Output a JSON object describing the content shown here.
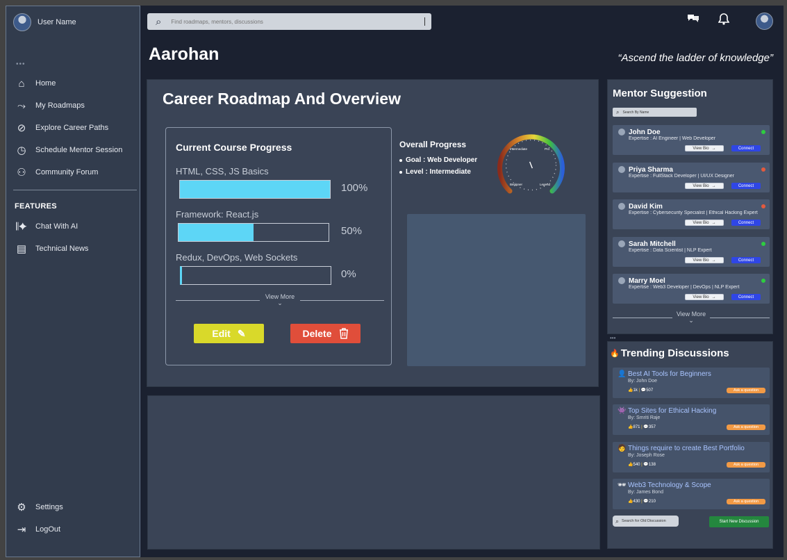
{
  "user": {
    "name": "User Name"
  },
  "sidebar": {
    "items": [
      {
        "label": "Home",
        "icon": "home-icon"
      },
      {
        "label": "My Roadmaps",
        "icon": "roadmap-icon"
      },
      {
        "label": "Explore Career Paths",
        "icon": "compass-icon"
      },
      {
        "label": "Schedule Mentor Session",
        "icon": "clock-icon"
      },
      {
        "label": "Community Forum",
        "icon": "community-icon"
      }
    ],
    "features_label": "FEATURES",
    "features": [
      {
        "label": "Chat With AI",
        "icon": "ai-sparkle-icon"
      },
      {
        "label": "Technical News",
        "icon": "news-icon"
      }
    ],
    "bottom": [
      {
        "label": "Settings",
        "icon": "gear-icon"
      },
      {
        "label": "LogOut",
        "icon": "logout-icon"
      }
    ]
  },
  "search": {
    "placeholder": "Find roadmaps, mentors, discussions"
  },
  "header": {
    "title": "Aarohan",
    "tagline": "“Ascend the ladder of knowledge”"
  },
  "career": {
    "title": "Career Roadmap And Overview",
    "progress_title": "Current Course Progress",
    "courses": [
      {
        "label": "HTML, CSS, JS Basics",
        "progress": 100,
        "pct_text": "100%"
      },
      {
        "label": "Framework: React.js",
        "progress": 50,
        "pct_text": "50%"
      },
      {
        "label": "Redux, DevOps, Web Sockets",
        "progress": 0,
        "pct_text": "0%"
      }
    ],
    "view_more": "View More",
    "edit_label": "Edit",
    "delete_label": "Delete",
    "overall_title": "Overall Progress",
    "goal": "Goal : Web Developer",
    "level": "Level : Intermediate",
    "gauge": {
      "labels": [
        "Intermediate",
        "Pro",
        "Beginner",
        "Legend"
      ],
      "value_fraction": 0.42
    }
  },
  "mentor": {
    "title": "Mentor Suggestion",
    "search_placeholder": "Search By Name",
    "bio_label": "View Bio",
    "connect_label": "Connect",
    "view_more": "View More",
    "mentors": [
      {
        "name": "John Doe",
        "expertise": "Expertise : AI Engineer | Web Developer",
        "status_color": "#2ecc40"
      },
      {
        "name": "Priya Sharma",
        "expertise": "Expertise : FullStack Developer | UI/UX Designer",
        "status_color": "#e35a3e"
      },
      {
        "name": "David Kim",
        "expertise": "Expertise : Cybersecurity Specialist | Ethical Hacking Expert",
        "status_color": "#e35a3e"
      },
      {
        "name": "Sarah Mitchell",
        "expertise": "Expertise : Data Scientist | NLP Expert",
        "status_color": "#2ecc40"
      },
      {
        "name": "Marry Moel",
        "expertise": "Expertise : Web3 Developer | DevOps | NLP Expert",
        "status_color": "#2ecc40"
      }
    ]
  },
  "trending": {
    "title": "Trending Discussions",
    "ask_label": "Ask a question",
    "search_placeholder": "Search for Old Discussion",
    "new_label": "Start New Discussion",
    "items": [
      {
        "title": "Best AI Tools for Beginners",
        "by": "By: John Doe",
        "likes": "1k",
        "comments": "507"
      },
      {
        "title": "Top Sites for Ethical Hacking",
        "by": "By: Smriti Raje",
        "likes": "871",
        "comments": "357"
      },
      {
        "title": "Things require to create Best Portfolio",
        "by": "By: Joseph Rose",
        "likes": "540",
        "comments": "138"
      },
      {
        "title": "Web3 Technology & Scope",
        "by": "By: James Bond",
        "likes": "430",
        "comments": "210"
      }
    ]
  },
  "colors": {
    "bg": "#1b2130",
    "panel": "#3a4456",
    "accent_bar": "#5dd6f6",
    "edit": "#d9d92a",
    "delete": "#e04e3a",
    "connect": "#2f46e6",
    "new_discussion": "#24873e",
    "ask": "#f29a45"
  }
}
